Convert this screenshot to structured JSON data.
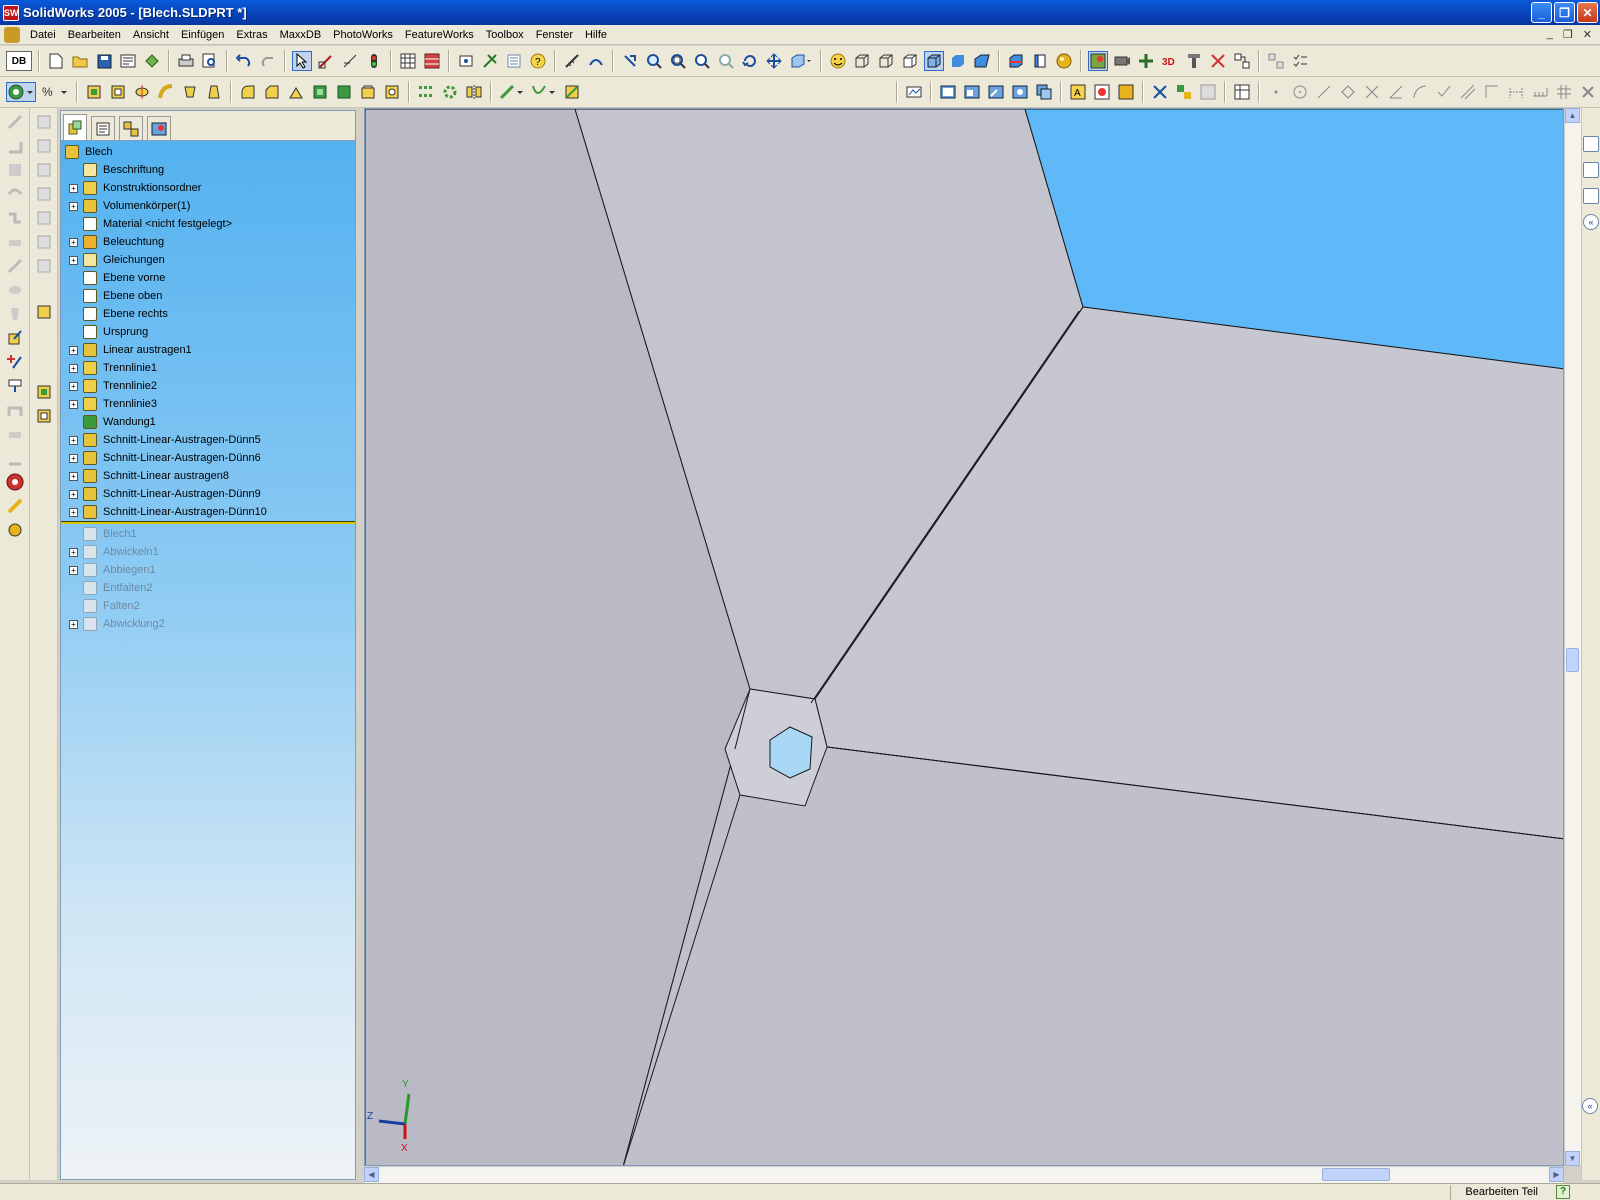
{
  "window": {
    "app_icon": "SW",
    "title": "SolidWorks 2005 - [Blech.SLDPRT *]",
    "controls": [
      "_",
      "❐",
      "✕"
    ]
  },
  "menu": {
    "items": [
      "Datei",
      "Bearbeiten",
      "Ansicht",
      "Einfügen",
      "Extras",
      "MaxxDB",
      "PhotoWorks",
      "FeatureWorks",
      "Toolbox",
      "Fenster",
      "Hilfe"
    ],
    "doc_controls": [
      "_",
      "❐",
      "✕"
    ]
  },
  "toolbar1": {
    "db_label": "DB",
    "icons": [
      "new-icon",
      "open-icon",
      "save-icon",
      "print-icon",
      "print-preview-icon",
      "undo-icon",
      "redo-icon",
      "select-icon",
      "sketch-icon",
      "smart-dimension-icon",
      "rebuild-icon",
      "options-icon",
      "help-icon",
      "zoom-fit-icon",
      "zoom-area-icon",
      "zoom-in-out-icon",
      "rotate-icon",
      "pan-icon",
      "view-orientation-icon",
      "wireframe-icon",
      "hidden-lines-icon",
      "shaded-icon",
      "perspective-icon",
      "section-view-icon",
      "realview-icon",
      "render-icon",
      "photoworks-icon",
      "toolbox-icon"
    ]
  },
  "toolbar2": {
    "icons": [
      "extrude-icon",
      "revolve-icon",
      "sweep-icon",
      "loft-icon",
      "fillet-icon",
      "chamfer-icon",
      "shell-icon",
      "rib-icon",
      "draft-icon",
      "hole-icon",
      "linear-pattern-icon",
      "circular-pattern-icon",
      "mirror-icon",
      "reference-plane-icon",
      "curve-icon",
      "split-line-icon",
      "sketch-tools-icon",
      "line-icon",
      "circle-icon",
      "arc-icon",
      "rectangle-icon",
      "trim-icon",
      "grid-icon",
      "close-panel-icon"
    ]
  },
  "feature_tree": {
    "tabs": [
      "featuremanager-tab",
      "propertymanager-tab",
      "configuration-tab",
      "display-tab"
    ],
    "root": "Blech",
    "items": [
      {
        "label": "Beschriftung",
        "icon": "annotations-icon",
        "expander": false,
        "suppressed": false
      },
      {
        "label": "Konstruktionsordner",
        "icon": "design-binder-icon",
        "expander": true,
        "suppressed": false
      },
      {
        "label": "Volumenkörper(1)",
        "icon": "solid-bodies-icon",
        "expander": true,
        "suppressed": false
      },
      {
        "label": "Material <nicht festgelegt>",
        "icon": "material-icon",
        "expander": false,
        "suppressed": false
      },
      {
        "label": "Beleuchtung",
        "icon": "lighting-icon",
        "expander": true,
        "suppressed": false
      },
      {
        "label": "Gleichungen",
        "icon": "equations-icon",
        "expander": true,
        "suppressed": false
      },
      {
        "label": "Ebene vorne",
        "icon": "plane-icon",
        "expander": false,
        "suppressed": false
      },
      {
        "label": "Ebene oben",
        "icon": "plane-icon",
        "expander": false,
        "suppressed": false
      },
      {
        "label": "Ebene rechts",
        "icon": "plane-icon",
        "expander": false,
        "suppressed": false
      },
      {
        "label": "Ursprung",
        "icon": "origin-icon",
        "expander": false,
        "suppressed": false
      },
      {
        "label": "Linear austragen1",
        "icon": "extrude-icon",
        "expander": true,
        "suppressed": false
      },
      {
        "label": "Trennlinie1",
        "icon": "split-line-icon",
        "expander": true,
        "suppressed": false
      },
      {
        "label": "Trennlinie2",
        "icon": "split-line-icon",
        "expander": true,
        "suppressed": false
      },
      {
        "label": "Trennlinie3",
        "icon": "split-line-icon",
        "expander": true,
        "suppressed": false
      },
      {
        "label": "Wandung1",
        "icon": "shell-icon",
        "expander": false,
        "suppressed": false
      },
      {
        "label": "Schnitt-Linear-Austragen-Dünn5",
        "icon": "cut-extrude-icon",
        "expander": true,
        "suppressed": false
      },
      {
        "label": "Schnitt-Linear-Austragen-Dünn6",
        "icon": "cut-extrude-icon",
        "expander": true,
        "suppressed": false
      },
      {
        "label": "Schnitt-Linear austragen8",
        "icon": "cut-extrude-icon",
        "expander": true,
        "suppressed": false
      },
      {
        "label": "Schnitt-Linear-Austragen-Dünn9",
        "icon": "cut-extrude-icon",
        "expander": true,
        "suppressed": false
      },
      {
        "label": "Schnitt-Linear-Austragen-Dünn10",
        "icon": "cut-extrude-icon",
        "expander": true,
        "suppressed": false
      },
      {
        "label": "Blech1",
        "icon": "sheet-metal-icon",
        "expander": false,
        "suppressed": true
      },
      {
        "label": "Abwickeln1",
        "icon": "unfold-icon",
        "expander": true,
        "suppressed": true
      },
      {
        "label": "Abbiegen1",
        "icon": "bend-icon",
        "expander": true,
        "suppressed": true
      },
      {
        "label": "Entfalten2",
        "icon": "unfold-icon",
        "expander": false,
        "suppressed": true
      },
      {
        "label": "Falten2",
        "icon": "fold-icon",
        "expander": false,
        "suppressed": true
      },
      {
        "label": "Abwicklung2",
        "icon": "flat-pattern-icon",
        "expander": true,
        "suppressed": true
      }
    ],
    "rollback_after_index": 19
  },
  "triad": {
    "x": "X",
    "y": "Y",
    "z": "Z"
  },
  "statusbar": {
    "mode": "Bearbeiten Teil",
    "help": "?"
  },
  "colors": {
    "accent": "#0a5ad9",
    "tree_bg": "#4fb0f0",
    "viewport_bg": "#bcbdc8",
    "model_face": "#c3c4ce",
    "sky_face": "#5fb8f7",
    "hole_face": "#a8d8f5"
  }
}
